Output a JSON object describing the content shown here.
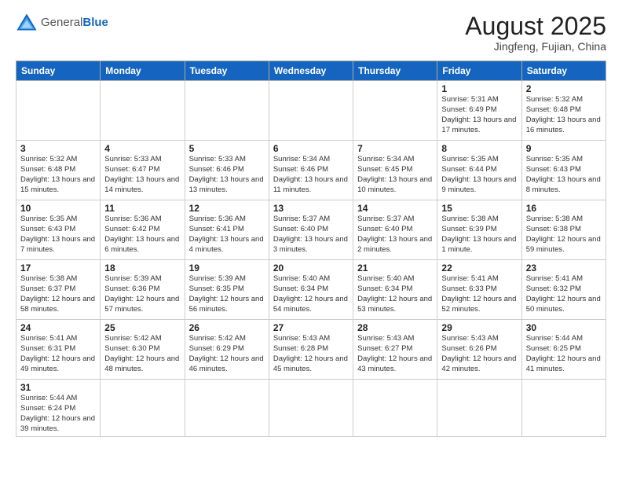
{
  "header": {
    "logo_general": "General",
    "logo_blue": "Blue",
    "month_title": "August 2025",
    "location": "Jingfeng, Fujian, China"
  },
  "days_of_week": [
    "Sunday",
    "Monday",
    "Tuesday",
    "Wednesday",
    "Thursday",
    "Friday",
    "Saturday"
  ],
  "weeks": [
    [
      {
        "day": "",
        "info": ""
      },
      {
        "day": "",
        "info": ""
      },
      {
        "day": "",
        "info": ""
      },
      {
        "day": "",
        "info": ""
      },
      {
        "day": "",
        "info": ""
      },
      {
        "day": "1",
        "info": "Sunrise: 5:31 AM\nSunset: 6:49 PM\nDaylight: 13 hours and 17 minutes."
      },
      {
        "day": "2",
        "info": "Sunrise: 5:32 AM\nSunset: 6:48 PM\nDaylight: 13 hours and 16 minutes."
      }
    ],
    [
      {
        "day": "3",
        "info": "Sunrise: 5:32 AM\nSunset: 6:48 PM\nDaylight: 13 hours and 15 minutes."
      },
      {
        "day": "4",
        "info": "Sunrise: 5:33 AM\nSunset: 6:47 PM\nDaylight: 13 hours and 14 minutes."
      },
      {
        "day": "5",
        "info": "Sunrise: 5:33 AM\nSunset: 6:46 PM\nDaylight: 13 hours and 13 minutes."
      },
      {
        "day": "6",
        "info": "Sunrise: 5:34 AM\nSunset: 6:46 PM\nDaylight: 13 hours and 11 minutes."
      },
      {
        "day": "7",
        "info": "Sunrise: 5:34 AM\nSunset: 6:45 PM\nDaylight: 13 hours and 10 minutes."
      },
      {
        "day": "8",
        "info": "Sunrise: 5:35 AM\nSunset: 6:44 PM\nDaylight: 13 hours and 9 minutes."
      },
      {
        "day": "9",
        "info": "Sunrise: 5:35 AM\nSunset: 6:43 PM\nDaylight: 13 hours and 8 minutes."
      }
    ],
    [
      {
        "day": "10",
        "info": "Sunrise: 5:35 AM\nSunset: 6:43 PM\nDaylight: 13 hours and 7 minutes."
      },
      {
        "day": "11",
        "info": "Sunrise: 5:36 AM\nSunset: 6:42 PM\nDaylight: 13 hours and 6 minutes."
      },
      {
        "day": "12",
        "info": "Sunrise: 5:36 AM\nSunset: 6:41 PM\nDaylight: 13 hours and 4 minutes."
      },
      {
        "day": "13",
        "info": "Sunrise: 5:37 AM\nSunset: 6:40 PM\nDaylight: 13 hours and 3 minutes."
      },
      {
        "day": "14",
        "info": "Sunrise: 5:37 AM\nSunset: 6:40 PM\nDaylight: 13 hours and 2 minutes."
      },
      {
        "day": "15",
        "info": "Sunrise: 5:38 AM\nSunset: 6:39 PM\nDaylight: 13 hours and 1 minute."
      },
      {
        "day": "16",
        "info": "Sunrise: 5:38 AM\nSunset: 6:38 PM\nDaylight: 12 hours and 59 minutes."
      }
    ],
    [
      {
        "day": "17",
        "info": "Sunrise: 5:38 AM\nSunset: 6:37 PM\nDaylight: 12 hours and 58 minutes."
      },
      {
        "day": "18",
        "info": "Sunrise: 5:39 AM\nSunset: 6:36 PM\nDaylight: 12 hours and 57 minutes."
      },
      {
        "day": "19",
        "info": "Sunrise: 5:39 AM\nSunset: 6:35 PM\nDaylight: 12 hours and 56 minutes."
      },
      {
        "day": "20",
        "info": "Sunrise: 5:40 AM\nSunset: 6:34 PM\nDaylight: 12 hours and 54 minutes."
      },
      {
        "day": "21",
        "info": "Sunrise: 5:40 AM\nSunset: 6:34 PM\nDaylight: 12 hours and 53 minutes."
      },
      {
        "day": "22",
        "info": "Sunrise: 5:41 AM\nSunset: 6:33 PM\nDaylight: 12 hours and 52 minutes."
      },
      {
        "day": "23",
        "info": "Sunrise: 5:41 AM\nSunset: 6:32 PM\nDaylight: 12 hours and 50 minutes."
      }
    ],
    [
      {
        "day": "24",
        "info": "Sunrise: 5:41 AM\nSunset: 6:31 PM\nDaylight: 12 hours and 49 minutes."
      },
      {
        "day": "25",
        "info": "Sunrise: 5:42 AM\nSunset: 6:30 PM\nDaylight: 12 hours and 48 minutes."
      },
      {
        "day": "26",
        "info": "Sunrise: 5:42 AM\nSunset: 6:29 PM\nDaylight: 12 hours and 46 minutes."
      },
      {
        "day": "27",
        "info": "Sunrise: 5:43 AM\nSunset: 6:28 PM\nDaylight: 12 hours and 45 minutes."
      },
      {
        "day": "28",
        "info": "Sunrise: 5:43 AM\nSunset: 6:27 PM\nDaylight: 12 hours and 43 minutes."
      },
      {
        "day": "29",
        "info": "Sunrise: 5:43 AM\nSunset: 6:26 PM\nDaylight: 12 hours and 42 minutes."
      },
      {
        "day": "30",
        "info": "Sunrise: 5:44 AM\nSunset: 6:25 PM\nDaylight: 12 hours and 41 minutes."
      }
    ],
    [
      {
        "day": "31",
        "info": "Sunrise: 5:44 AM\nSunset: 6:24 PM\nDaylight: 12 hours and 39 minutes."
      },
      {
        "day": "",
        "info": ""
      },
      {
        "day": "",
        "info": ""
      },
      {
        "day": "",
        "info": ""
      },
      {
        "day": "",
        "info": ""
      },
      {
        "day": "",
        "info": ""
      },
      {
        "day": "",
        "info": ""
      }
    ]
  ]
}
